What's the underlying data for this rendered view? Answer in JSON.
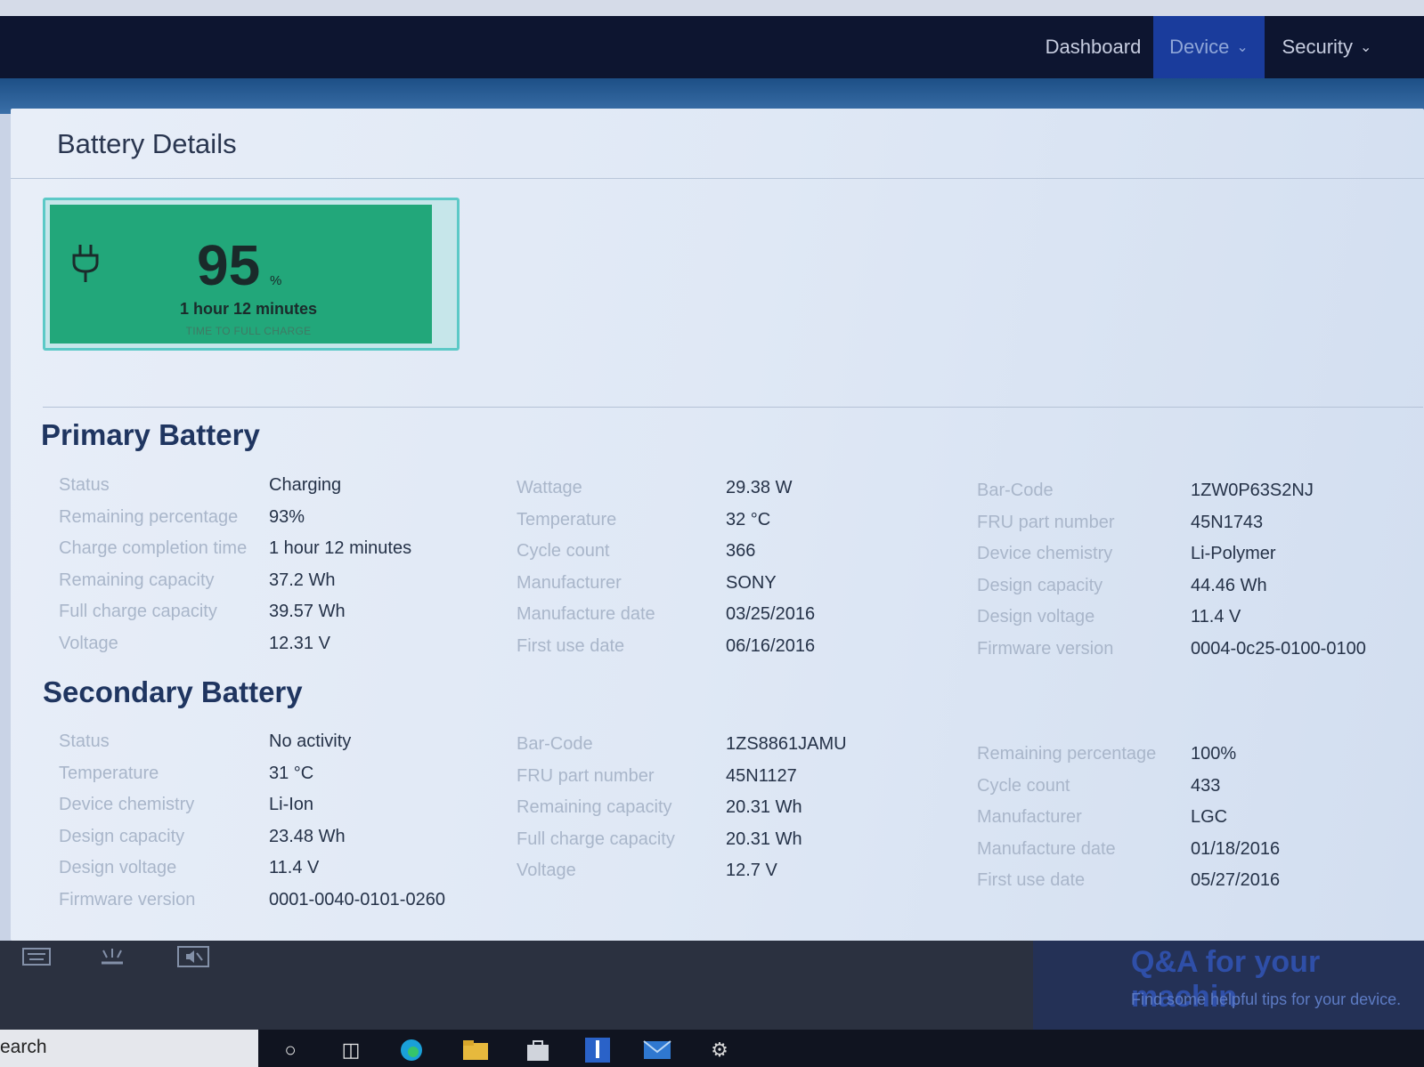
{
  "nav": {
    "items": [
      {
        "label": "Dashboard"
      },
      {
        "label": "Device"
      },
      {
        "label": "Security"
      }
    ]
  },
  "panel": {
    "title": "Battery Details"
  },
  "battery": {
    "percentage": "95",
    "percent_sign": "%",
    "charge_time": "1 hour 12 minutes",
    "charge_time_label": "TIME TO FULL CHARGE",
    "fill_level": 0.95,
    "fill_color": "#22a77a"
  },
  "primary": {
    "title": "Primary Battery",
    "col1": [
      {
        "key": "Status",
        "value": "Charging"
      },
      {
        "key": "Remaining percentage",
        "value": "93%"
      },
      {
        "key": "Charge completion time",
        "value": "1 hour 12 minutes"
      },
      {
        "key": "Remaining capacity",
        "value": "37.2 Wh"
      },
      {
        "key": "Full charge capacity",
        "value": "39.57 Wh"
      },
      {
        "key": "Voltage",
        "value": "12.31 V"
      }
    ],
    "col2": [
      {
        "key": "Wattage",
        "value": "29.38 W"
      },
      {
        "key": "Temperature",
        "value": "32 °C"
      },
      {
        "key": "Cycle count",
        "value": "366"
      },
      {
        "key": "Manufacturer",
        "value": "SONY"
      },
      {
        "key": "Manufacture date",
        "value": "03/25/2016"
      },
      {
        "key": "First use date",
        "value": "06/16/2016"
      }
    ],
    "col3": [
      {
        "key": "Bar-Code",
        "value": "1ZW0P63S2NJ"
      },
      {
        "key": "FRU part number",
        "value": "45N1743"
      },
      {
        "key": "Device chemistry",
        "value": "Li-Polymer"
      },
      {
        "key": "Design capacity",
        "value": "44.46 Wh"
      },
      {
        "key": "Design voltage",
        "value": "11.4 V"
      },
      {
        "key": "Firmware version",
        "value": "0004-0c25-0100-0100"
      }
    ]
  },
  "secondary": {
    "title": "Secondary Battery",
    "col1": [
      {
        "key": "Status",
        "value": "No activity"
      },
      {
        "key": "Temperature",
        "value": "31 °C"
      },
      {
        "key": "Device chemistry",
        "value": "Li-Ion"
      },
      {
        "key": "Design capacity",
        "value": "23.48 Wh"
      },
      {
        "key": "Design voltage",
        "value": "11.4 V"
      },
      {
        "key": "Firmware version",
        "value": "0001-0040-0101-0260"
      }
    ],
    "col2": [
      {
        "key": "Bar-Code",
        "value": "1ZS8861JAMU"
      },
      {
        "key": "FRU part number",
        "value": "45N1127"
      },
      {
        "key": "Remaining capacity",
        "value": "20.31 Wh"
      },
      {
        "key": "Full charge capacity",
        "value": "20.31 Wh"
      },
      {
        "key": "Voltage",
        "value": "12.7 V"
      }
    ],
    "col3": [
      {
        "key": "Remaining percentage",
        "value": "100%"
      },
      {
        "key": "Cycle count",
        "value": "433"
      },
      {
        "key": "Manufacturer",
        "value": "LGC"
      },
      {
        "key": "Manufacture date",
        "value": "01/18/2016"
      },
      {
        "key": "First use date",
        "value": "05/27/2016"
      }
    ]
  },
  "qa": {
    "title": "Q&A for your machin",
    "subtitle": "Find some helpful tips for your device."
  },
  "taskbar": {
    "search_text": "earch"
  },
  "icons": {
    "plug": "plug-icon",
    "keyboard": "keyboard-icon",
    "keyboard_backlight": "keyboard-backlight-icon",
    "mute": "mute-icon"
  }
}
